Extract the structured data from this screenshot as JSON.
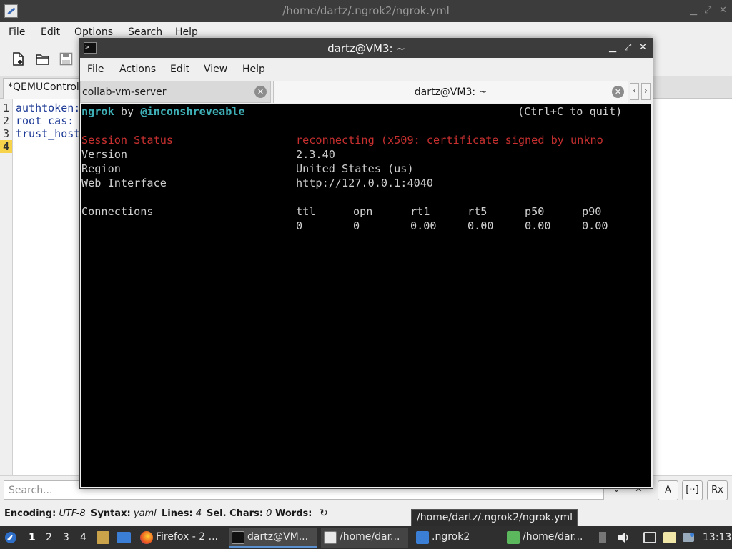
{
  "editor": {
    "title": "/home/dartz/.ngrok2/ngrok.yml",
    "menu": [
      "File",
      "Edit",
      "Options",
      "Search",
      "Help"
    ],
    "tab_label": "*QEMUControl",
    "line_numbers": [
      "1",
      "2",
      "3",
      "4"
    ],
    "lines": [
      "authtoken:",
      "root_cas:",
      "trust_host",
      ""
    ],
    "search_placeholder": "Search...",
    "status": {
      "encoding_label": "Encoding:",
      "encoding_value": "UTF-8",
      "syntax_label": "Syntax:",
      "syntax_value": "yaml",
      "lines_label": "Lines:",
      "lines_value": "4",
      "selchars_label": "Sel. Chars:",
      "selchars_value": "0",
      "words_label": "Words:"
    },
    "search_buttons": [
      "A",
      "[··]",
      "Rx"
    ]
  },
  "terminal": {
    "title": "dartz@VM3: ~",
    "menu": [
      "File",
      "Actions",
      "Edit",
      "View",
      "Help"
    ],
    "tabs": [
      {
        "label": "collab-vm-server"
      },
      {
        "label": "dartz@VM3: ~"
      }
    ],
    "ngrok": {
      "brand": "ngrok",
      "by": "by",
      "author": "@inconshreveable",
      "quit_hint": "(Ctrl+C to quit)",
      "session_status_label": "Session Status",
      "session_status_value": "reconnecting (x509: certificate signed by unkno",
      "version_label": "Version",
      "version_value": "2.3.40",
      "region_label": "Region",
      "region_value": "United States (us)",
      "web_interface_label": "Web Interface",
      "web_interface_value": "http://127.0.0.1:4040",
      "connections_label": "Connections",
      "conn_headers": [
        "ttl",
        "opn",
        "rt1",
        "rt5",
        "p50",
        "p90"
      ],
      "conn_values": [
        "0",
        "0",
        "0.00",
        "0.00",
        "0.00",
        "0.00"
      ]
    }
  },
  "tooltip": "/home/dartz/.ngrok2/ngrok.yml",
  "taskbar": {
    "workspaces": [
      "1",
      "2",
      "3",
      "4"
    ],
    "tasks": [
      {
        "label": "Firefox - 2 ..."
      },
      {
        "label": "dartz@VM..."
      },
      {
        "label": "/home/dar..."
      },
      {
        "label": ".ngrok2"
      },
      {
        "label": "/home/dar..."
      }
    ],
    "clock": "13:13"
  },
  "colors": {
    "terminal_bg": "#000000",
    "ngrok_red": "#c7302f",
    "ngrok_cyan": "#3fb0b8",
    "titlebar": "#3c3c3c",
    "taskbar": "#2f2f2f",
    "current_line_marker": "#f6d34a"
  }
}
